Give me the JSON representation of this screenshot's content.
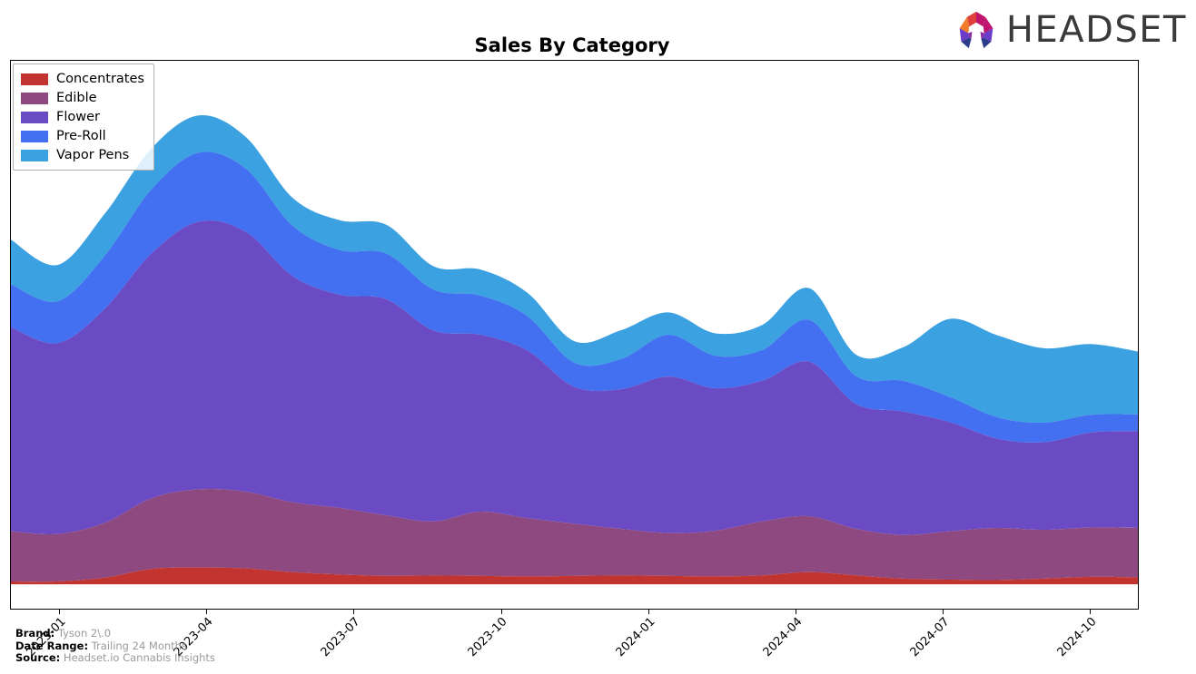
{
  "header": {
    "title": "Sales By Category",
    "logo_text": "HEADSET",
    "logo_icon": "headset-hexagon-logo"
  },
  "legend": {
    "position": "upper-left",
    "items": [
      {
        "label": "Concentrates",
        "color": "#C1342F"
      },
      {
        "label": "Edible",
        "color": "#8E4A80"
      },
      {
        "label": "Flower",
        "color": "#6A4BC4"
      },
      {
        "label": "Pre-Roll",
        "color": "#4270F0"
      },
      {
        "label": "Vapor Pens",
        "color": "#3BA1E0"
      }
    ]
  },
  "footer": {
    "lines": [
      {
        "key": "Brand:",
        "value": "Tyson 2\\.0"
      },
      {
        "key": "Date Range:",
        "value": "Trailing 24 Months"
      },
      {
        "key": "Source:",
        "value": "Headset.io Cannabis Insights"
      }
    ]
  },
  "chart_data": {
    "type": "area",
    "stacked": true,
    "smoothing": "spline",
    "title": "Sales By Category",
    "xlabel": "",
    "ylabel": "",
    "grid": false,
    "legend_position": "upper-left",
    "x_tick_labels": [
      "2023-01",
      "2023-04",
      "2023-07",
      "2023-10",
      "2024-01",
      "2024-04",
      "2024-07",
      "2024-10"
    ],
    "x_tick_positions": [
      0.0435,
      0.1739,
      0.3043,
      0.4348,
      0.5652,
      0.6957,
      0.8261,
      0.9565
    ],
    "x": [
      "2022-11",
      "2022-12",
      "2023-01",
      "2023-02",
      "2023-03",
      "2023-04",
      "2023-05",
      "2023-06",
      "2023-07",
      "2023-08",
      "2023-09",
      "2023-10",
      "2023-11",
      "2023-12",
      "2024-01",
      "2024-02",
      "2024-03",
      "2024-04",
      "2024-05",
      "2024-06",
      "2024-07",
      "2024-08",
      "2024-09",
      "2024-10",
      "2024-11"
    ],
    "ylim": [
      0,
      100
    ],
    "units": "relative sales (indexed, y-axis unlabeled)",
    "series": [
      {
        "name": "Concentrates",
        "color": "#C1342F",
        "values": [
          0.6,
          0.6,
          1.4,
          3.3,
          3.6,
          3.4,
          2.6,
          2.1,
          1.8,
          1.9,
          1.8,
          1.7,
          1.8,
          1.9,
          1.8,
          1.7,
          1.9,
          2.6,
          1.9,
          1.2,
          1.0,
          0.9,
          1.2,
          1.6,
          1.5
        ]
      },
      {
        "name": "Edible",
        "color": "#8E4A80",
        "values": [
          10.8,
          10.2,
          11.8,
          15.2,
          16.8,
          16.5,
          15.0,
          14.3,
          13.0,
          11.6,
          13.8,
          12.5,
          11.2,
          10.0,
          9.2,
          9.8,
          11.6,
          12.0,
          10.0,
          9.4,
          10.4,
          11.2,
          10.5,
          10.6,
          10.6
        ]
      },
      {
        "name": "Flower",
        "color": "#6A4BC4",
        "values": [
          43.8,
          41.0,
          46.0,
          52.6,
          57.5,
          55.8,
          48.6,
          45.8,
          46.4,
          41.0,
          38.0,
          36.0,
          29.4,
          30.0,
          33.6,
          30.6,
          30.2,
          33.2,
          26.8,
          26.5,
          23.4,
          19.2,
          18.8,
          20.4,
          20.8
        ]
      },
      {
        "name": "Pre-Roll",
        "color": "#4270F0",
        "values": [
          9.2,
          9.0,
          11.4,
          13.8,
          14.8,
          13.6,
          10.8,
          9.6,
          9.8,
          8.8,
          8.4,
          7.4,
          5.2,
          6.5,
          9.0,
          7.0,
          6.6,
          9.0,
          6.0,
          6.6,
          5.4,
          4.6,
          4.2,
          3.8,
          3.6
        ]
      },
      {
        "name": "Vapor Pens",
        "color": "#3BA1E0",
        "values": [
          9.6,
          7.8,
          9.0,
          8.8,
          8.0,
          6.8,
          6.0,
          6.4,
          6.2,
          5.0,
          5.6,
          5.0,
          4.6,
          6.2,
          4.8,
          4.8,
          5.4,
          6.8,
          4.6,
          7.2,
          16.8,
          17.6,
          16.0,
          15.2,
          13.5
        ]
      }
    ]
  }
}
